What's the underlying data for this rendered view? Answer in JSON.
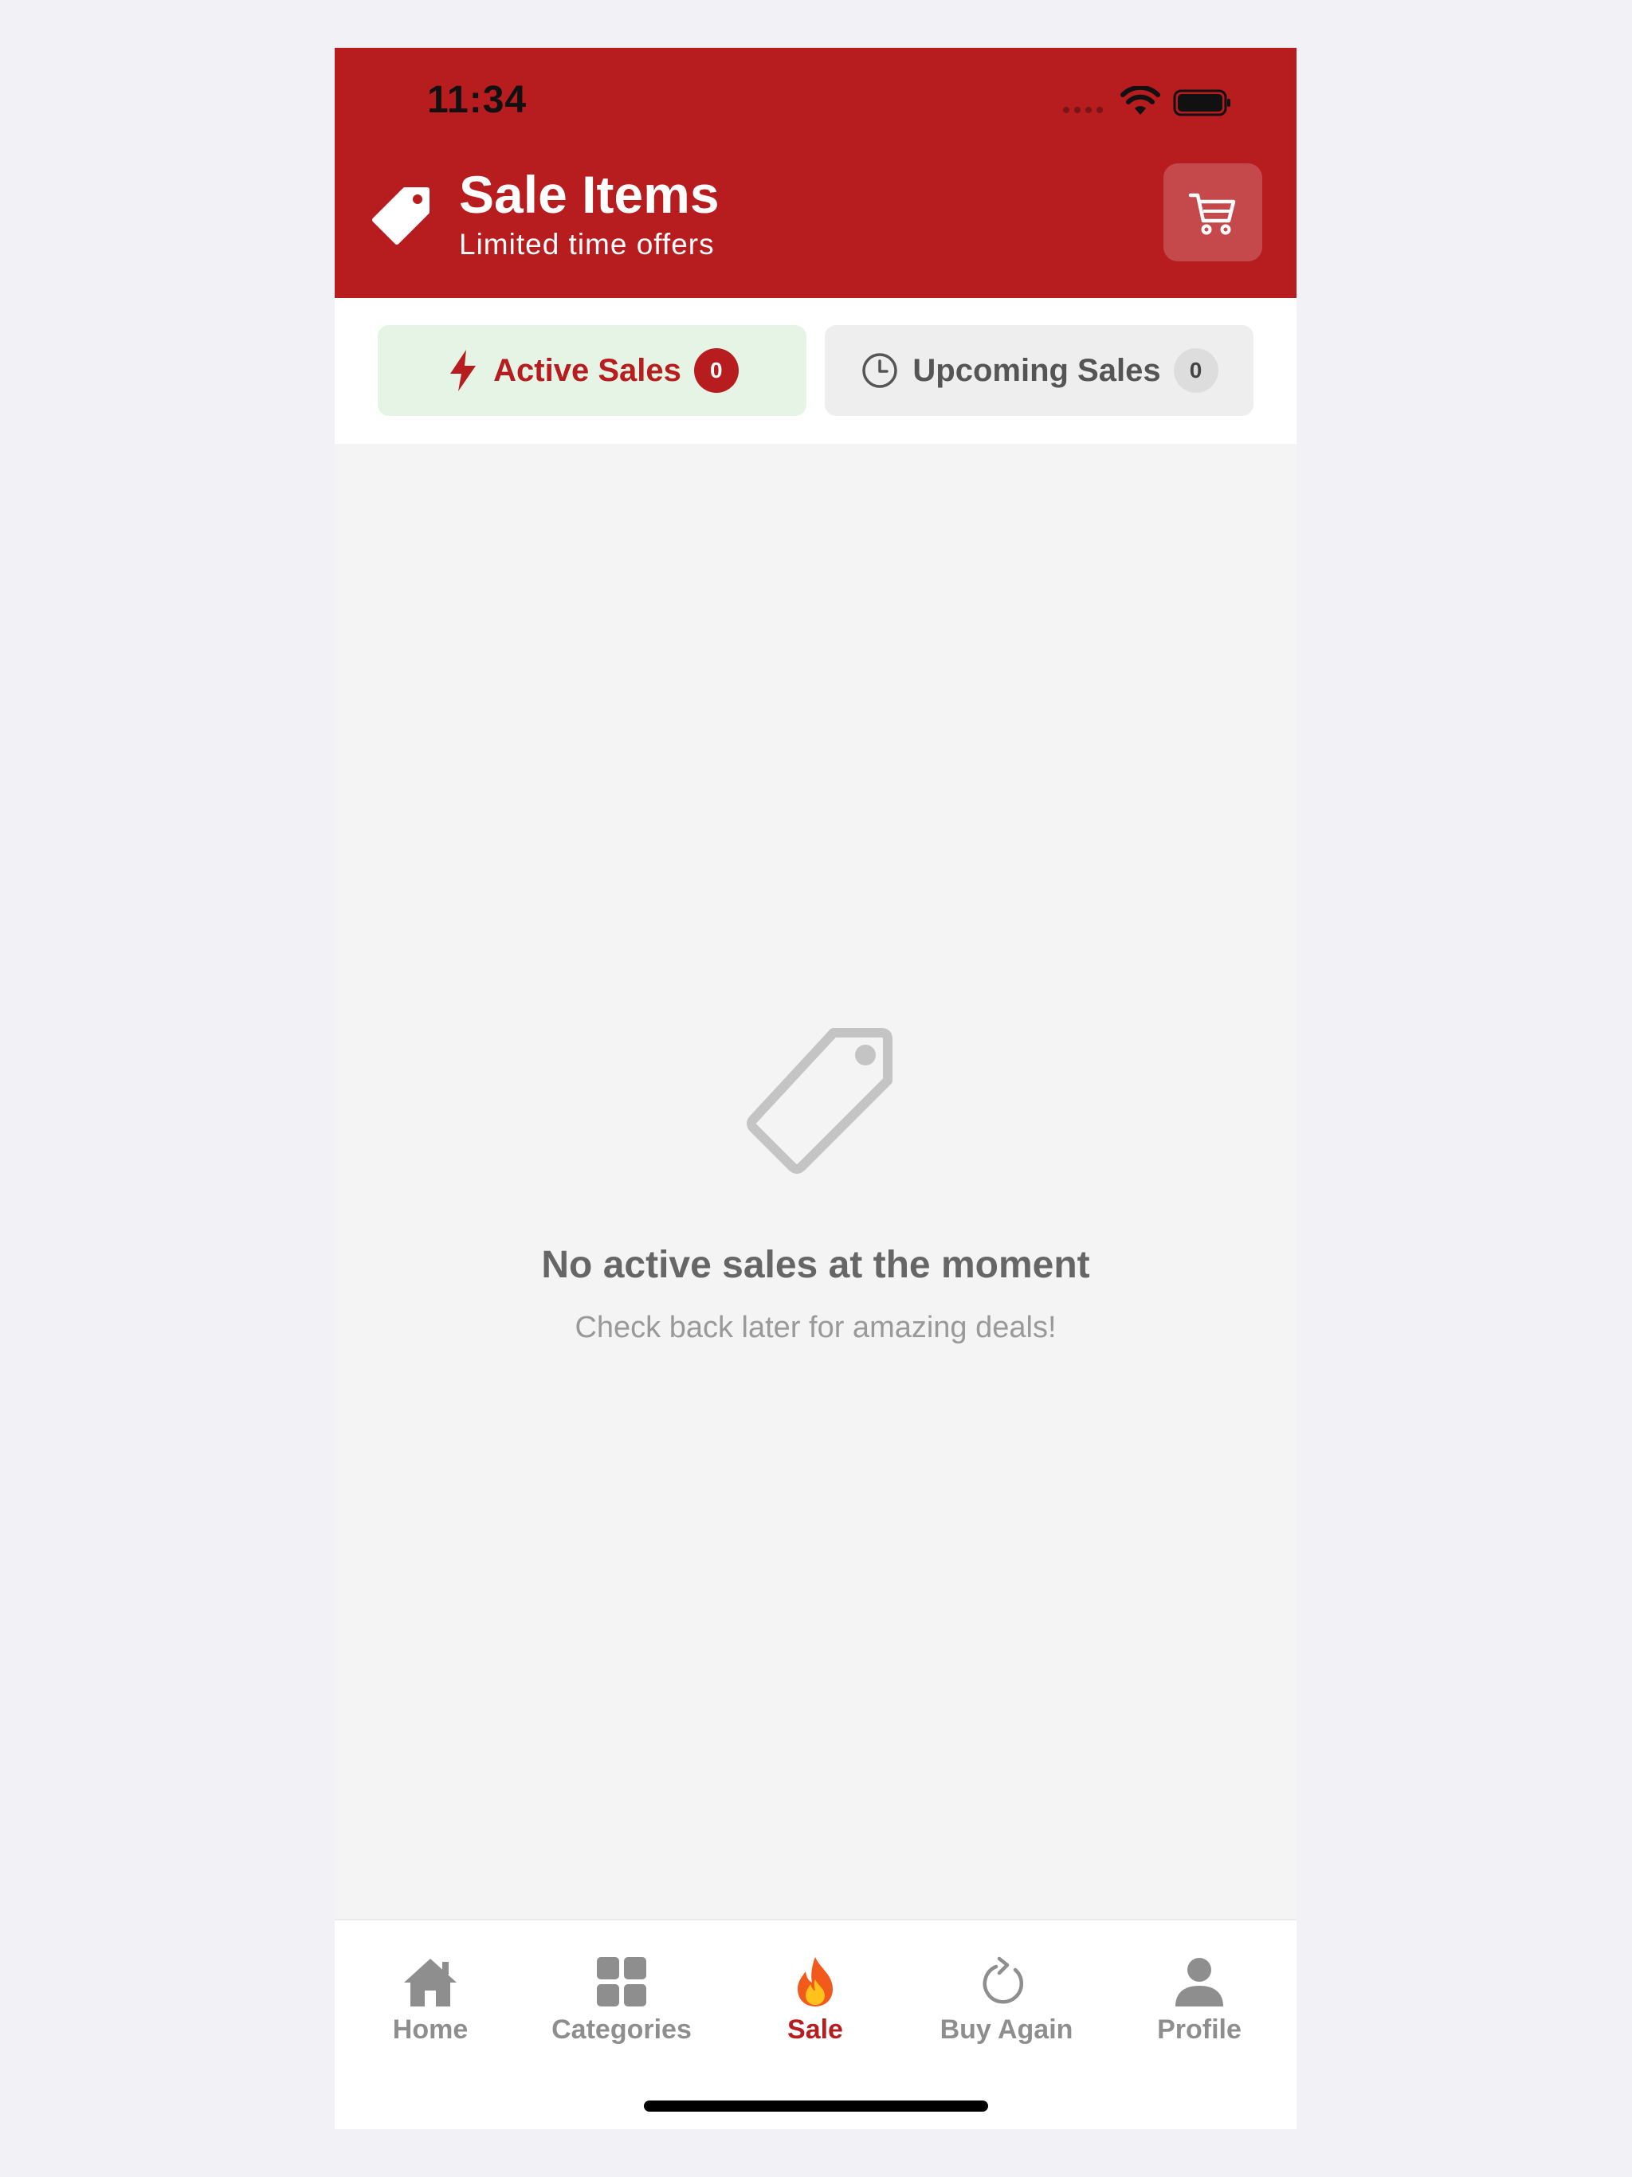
{
  "status_bar": {
    "time": "11:34",
    "wifi_icon": "wifi-icon",
    "battery_icon": "battery-icon"
  },
  "header": {
    "icon": "tag-icon",
    "title": "Sale Items",
    "subtitle": "Limited time offers",
    "cart_icon": "cart-icon",
    "background_color": "#b71c1f"
  },
  "tabs": [
    {
      "label": "Active Sales",
      "count": "0",
      "icon": "bolt-icon",
      "selected": true,
      "color": "#b71c1f"
    },
    {
      "label": "Upcoming Sales",
      "count": "0",
      "icon": "clock-icon",
      "selected": false,
      "color": "#555555"
    }
  ],
  "empty_state": {
    "icon": "tag-outline-icon",
    "title": "No active sales at the moment",
    "subtitle": "Check back later for amazing deals!"
  },
  "bottom_nav": {
    "items": [
      {
        "label": "Home",
        "icon": "home-icon",
        "active": false
      },
      {
        "label": "Categories",
        "icon": "grid-icon",
        "active": false
      },
      {
        "label": "Sale",
        "icon": "fire-icon",
        "active": true
      },
      {
        "label": "Buy Again",
        "icon": "refresh-icon",
        "active": false
      },
      {
        "label": "Profile",
        "icon": "person-icon",
        "active": false
      }
    ],
    "active_color": "#b71c1f",
    "inactive_color": "#8e8e8e"
  }
}
